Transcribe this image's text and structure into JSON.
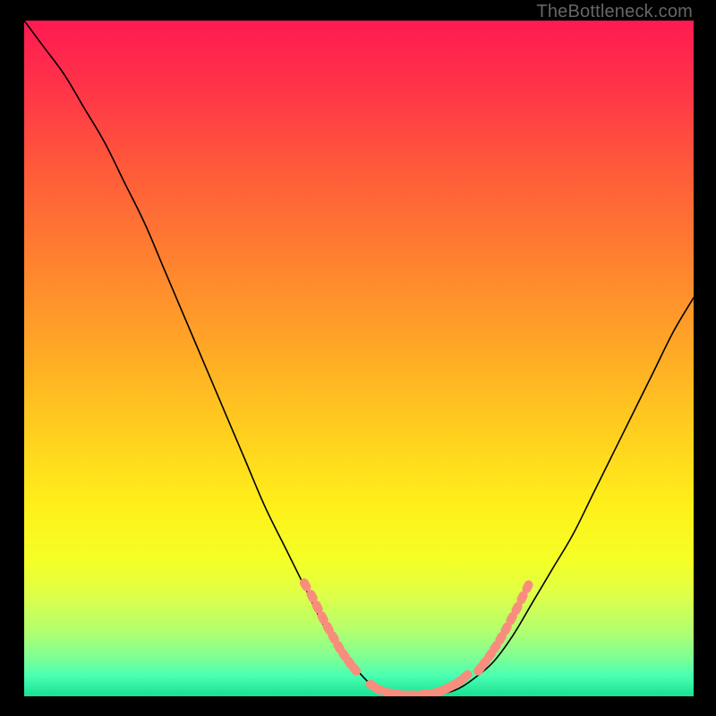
{
  "watermark": "TheBottleneck.com",
  "chart_data": {
    "type": "line",
    "title": "",
    "xlabel": "",
    "ylabel": "",
    "xlim": [
      0,
      100
    ],
    "ylim": [
      0,
      100
    ],
    "grid": false,
    "series": [
      {
        "name": "curve",
        "color": "#000000",
        "x": [
          0,
          3,
          6,
          9,
          12,
          15,
          18,
          21,
          24,
          27,
          30,
          33,
          36,
          39,
          42,
          45,
          48,
          51,
          53,
          55,
          57,
          60,
          63,
          65,
          67,
          70,
          73,
          76,
          79,
          82,
          85,
          88,
          91,
          94,
          97,
          100
        ],
        "y": [
          100,
          96,
          92,
          87,
          82,
          76,
          70,
          63,
          56,
          49,
          42,
          35,
          28,
          22,
          16,
          10,
          6,
          2.5,
          1,
          0.4,
          0.2,
          0.2,
          0.5,
          1.2,
          2.5,
          5,
          9,
          14,
          19,
          24,
          30,
          36,
          42,
          48,
          54,
          59
        ]
      },
      {
        "name": "left-dot-strip",
        "type": "scatter",
        "color": "#f98d7d",
        "x": [
          42,
          43,
          43.8,
          44.6,
          45.4,
          46.2,
          47,
          47.8,
          48.6,
          49.4
        ],
        "y": [
          16.5,
          14.8,
          13.2,
          11.6,
          10.1,
          8.7,
          7.3,
          6.1,
          5.0,
          4.0
        ]
      },
      {
        "name": "bottom-dot-strip",
        "type": "scatter",
        "color": "#f98d7d",
        "x": [
          52,
          53,
          54.5,
          55.7,
          56.8,
          58,
          59.5,
          60.8,
          62,
          63,
          64,
          65,
          66
        ],
        "y": [
          1.6,
          1.0,
          0.5,
          0.3,
          0.2,
          0.2,
          0.25,
          0.4,
          0.7,
          1.1,
          1.6,
          2.2,
          3.0
        ]
      },
      {
        "name": "right-dot-strip",
        "type": "scatter",
        "color": "#f98d7d",
        "x": [
          68,
          68.8,
          69.6,
          70.4,
          71.2,
          72,
          72.8,
          73.6,
          74.4,
          75.2
        ],
        "y": [
          4.0,
          5.0,
          6.1,
          7.3,
          8.6,
          10.0,
          11.5,
          13.0,
          14.6,
          16.2
        ]
      }
    ],
    "gradient_stops": [
      {
        "offset": 0.0,
        "color": "#ff1a52"
      },
      {
        "offset": 0.1,
        "color": "#ff3448"
      },
      {
        "offset": 0.22,
        "color": "#ff5a3a"
      },
      {
        "offset": 0.35,
        "color": "#ff8030"
      },
      {
        "offset": 0.48,
        "color": "#ffa626"
      },
      {
        "offset": 0.6,
        "color": "#ffcc1f"
      },
      {
        "offset": 0.72,
        "color": "#fff01a"
      },
      {
        "offset": 0.8,
        "color": "#f4ff26"
      },
      {
        "offset": 0.85,
        "color": "#deff48"
      },
      {
        "offset": 0.9,
        "color": "#b6ff6c"
      },
      {
        "offset": 0.94,
        "color": "#82ff92"
      },
      {
        "offset": 0.97,
        "color": "#4affb2"
      },
      {
        "offset": 1.0,
        "color": "#18e094"
      }
    ]
  }
}
